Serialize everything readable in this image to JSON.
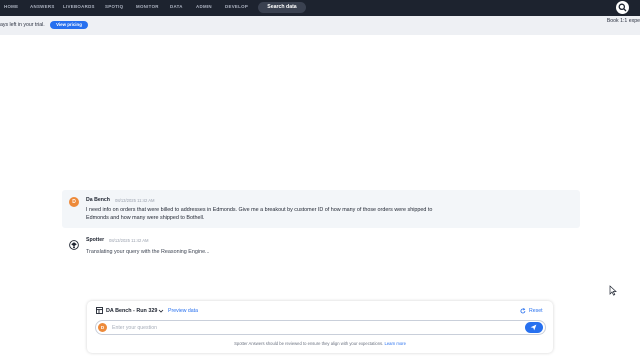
{
  "nav": {
    "items": [
      "HOME",
      "ANSWERS",
      "LIVEBOARDS",
      "SPOTIQ",
      "MONITOR",
      "DATA",
      "ADMIN",
      "DEVELOP"
    ],
    "search_label": "Search data"
  },
  "banner": {
    "text": "ays left in your trial.",
    "pricing_label": "View pricing",
    "right_text": "Book 1:1 expe"
  },
  "conversation": {
    "user_initial": "D",
    "user_name": "Da Bench",
    "user_time": "08/13/2025 11:42 AM",
    "user_message": "I need info on orders that were billed to addresses in Edmonds. Give me a breakout by customer ID of how many of those orders were shipped to Edmonds and how many were shipped to Bothell.",
    "bot_name": "Spotter",
    "bot_time": "08/13/2025 11:42 AM",
    "bot_message": "Translating your query with the Reasoning Engine..."
  },
  "composer": {
    "dataset": "DA Bench - Run 329",
    "preview_label": "Preview data",
    "reset_label": "Reset",
    "avatar_initial": "D",
    "placeholder": "Enter your question",
    "disclaimer": "Spotter Answers should be reviewed to ensure they align with your expectations.",
    "learn_more": "Learn more"
  },
  "colors": {
    "nav_bg": "#1d232f",
    "accent": "#2770ef",
    "avatar": "#ed8a3a"
  }
}
